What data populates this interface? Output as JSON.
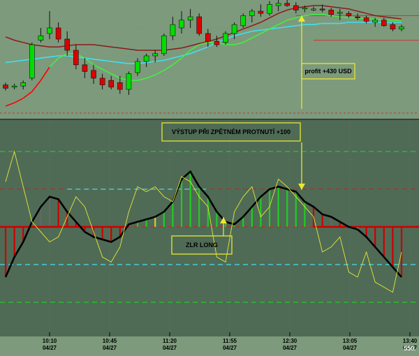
{
  "chart_data": [
    {
      "type": "candlestick",
      "panel": "price",
      "ylim": [
        0,
        100
      ],
      "colors": {
        "up": "#00dd00",
        "down": "#dd0000",
        "ma_slow": "#8b1a1a",
        "ma_fast_up": "#44ee44",
        "ma_fast_down": "#ff0000",
        "ma_cyan": "#40e0f0",
        "guide": "#cc3333",
        "background": "#7d9a7c"
      },
      "candles": [
        [
          24,
          26,
          19,
          21
        ],
        [
          22,
          25,
          20,
          23
        ],
        [
          23,
          28,
          20,
          26
        ],
        [
          30,
          62,
          28,
          60
        ],
        [
          64,
          75,
          62,
          68
        ],
        [
          70,
          90,
          65,
          75
        ],
        [
          75,
          80,
          62,
          65
        ],
        [
          65,
          72,
          50,
          55
        ],
        [
          55,
          60,
          38,
          42
        ],
        [
          42,
          48,
          30,
          36
        ],
        [
          37,
          42,
          25,
          30
        ],
        [
          30,
          34,
          20,
          24
        ],
        [
          28,
          32,
          20,
          22
        ],
        [
          26,
          32,
          16,
          20
        ],
        [
          20,
          36,
          15,
          34
        ],
        [
          35,
          48,
          32,
          45
        ],
        [
          45,
          52,
          40,
          50
        ],
        [
          50,
          55,
          44,
          52
        ],
        [
          52,
          70,
          50,
          68
        ],
        [
          68,
          85,
          64,
          78
        ],
        [
          75,
          90,
          70,
          82
        ],
        [
          82,
          92,
          75,
          85
        ],
        [
          85,
          88,
          68,
          70
        ],
        [
          70,
          74,
          58,
          63
        ],
        [
          63,
          68,
          58,
          60
        ],
        [
          62,
          72,
          60,
          70
        ],
        [
          70,
          80,
          65,
          78
        ],
        [
          77,
          88,
          75,
          86
        ],
        [
          86,
          92,
          80,
          90
        ],
        [
          90,
          96,
          85,
          88
        ],
        [
          88,
          99,
          86,
          96
        ],
        [
          95,
          100,
          90,
          97
        ],
        [
          97,
          100,
          94,
          95
        ],
        [
          95,
          98,
          88,
          91
        ],
        [
          92,
          95,
          89,
          93
        ],
        [
          92,
          94,
          90,
          92
        ],
        [
          92,
          96,
          89,
          91
        ],
        [
          91,
          93,
          85,
          87
        ],
        [
          88,
          92,
          82,
          89
        ],
        [
          88,
          90,
          84,
          86
        ],
        [
          85,
          88,
          82,
          84
        ],
        [
          84,
          86,
          79,
          81
        ],
        [
          80,
          84,
          76,
          82
        ],
        [
          82,
          84,
          76,
          77
        ],
        [
          78,
          80,
          72,
          74
        ],
        [
          74,
          78,
          72,
          76
        ]
      ],
      "ma_slow": [
        67,
        64,
        62,
        60,
        59,
        58,
        58,
        59,
        60,
        60,
        60,
        59,
        58,
        57,
        56,
        55,
        55,
        55,
        55,
        56,
        57,
        59,
        61,
        63,
        65,
        68,
        71,
        74,
        77,
        80,
        84,
        88,
        91,
        93,
        94,
        95,
        95,
        94,
        93,
        92,
        90,
        88,
        86,
        85,
        84,
        83
      ],
      "ma_fast": [
        5,
        8,
        12,
        18,
        28,
        40,
        48,
        52,
        52,
        48,
        42,
        38,
        34,
        30,
        28,
        28,
        30,
        33,
        37,
        42,
        48,
        55,
        60,
        62,
        62,
        60,
        60,
        62,
        66,
        70,
        74,
        78,
        82,
        84,
        86,
        87,
        87,
        86,
        85,
        84,
        84,
        83,
        83,
        82,
        82,
        82
      ],
      "ma_fast_color": [
        "down",
        "down",
        "down",
        "down",
        "down",
        "down",
        "up",
        "up",
        "up",
        "up",
        "up",
        "up",
        "up",
        "up",
        "up",
        "up",
        "up",
        "up",
        "up",
        "up",
        "up",
        "up",
        "up",
        "up",
        "up",
        "up",
        "up",
        "up",
        "up",
        "up",
        "up",
        "up",
        "up",
        "up",
        "up",
        "up",
        "up",
        "up",
        "up",
        "up",
        "up",
        "up",
        "up",
        "up",
        "up",
        "up"
      ],
      "ma_cyan": [
        44,
        45,
        46,
        47,
        48,
        49,
        50,
        50,
        49,
        48,
        47,
        46,
        45,
        44,
        43,
        43,
        44,
        45,
        46,
        48,
        50,
        52,
        55,
        58,
        62,
        65,
        68,
        70,
        72,
        73,
        74,
        75,
        76,
        77,
        78,
        78,
        79,
        79,
        79,
        80,
        80,
        80,
        80,
        80,
        80,
        80
      ],
      "annotations": [
        {
          "text": "profit +430 USD"
        }
      ]
    },
    {
      "type": "line",
      "panel": "oscillator",
      "ylim": [
        -200,
        200
      ],
      "levels": [
        {
          "value": 150,
          "color": "#22cc22"
        },
        {
          "value": 75,
          "color": "#cc2222"
        },
        {
          "value": 75,
          "color": "#40e0f0",
          "start": 7,
          "end": 23
        },
        {
          "value": 0,
          "color": "#cc2222"
        },
        {
          "value": -75,
          "color": "#40e0f0"
        },
        {
          "value": -150,
          "color": "#22cc22"
        }
      ],
      "series": [
        {
          "style": "thick",
          "color": "#000000",
          "values": [
            -100,
            -60,
            -30,
            10,
            40,
            60,
            55,
            30,
            10,
            -10,
            -20,
            -25,
            -30,
            -20,
            5,
            10,
            15,
            20,
            30,
            50,
            95,
            110,
            80,
            60,
            30,
            10,
            5,
            20,
            40,
            60,
            75,
            80,
            75,
            70,
            50,
            40,
            25,
            20,
            10,
            0,
            -5,
            -20,
            -40,
            -60,
            -80,
            -100
          ]
        },
        {
          "style": "thin",
          "color": "#e8e830",
          "values": [
            90,
            150,
            80,
            10,
            -10,
            -30,
            -20,
            20,
            60,
            40,
            -10,
            -60,
            -70,
            -40,
            30,
            80,
            70,
            80,
            60,
            50,
            100,
            90,
            60,
            40,
            -60,
            -70,
            30,
            60,
            80,
            20,
            40,
            95,
            80,
            60,
            40,
            20,
            -50,
            -40,
            -20,
            -90,
            -100,
            -50,
            -110,
            -120,
            -130,
            -50
          ]
        }
      ],
      "histogram": {
        "values": [
          -100,
          -60,
          -30,
          10,
          40,
          60,
          55,
          30,
          10,
          -10,
          -20,
          -25,
          -30,
          -20,
          5,
          10,
          15,
          20,
          30,
          50,
          95,
          110,
          80,
          60,
          30,
          10,
          5,
          20,
          40,
          60,
          75,
          80,
          75,
          70,
          50,
          40,
          25,
          20,
          10,
          0,
          -5,
          -20,
          -40,
          -60,
          -80,
          -100
        ],
        "colors": [
          "#cc0000",
          "#cc0000",
          "#cc0000",
          "#666666",
          "#666666",
          "#666666",
          "#cc0000",
          "#cc0000",
          "#cc0000",
          "#cc0000",
          "#cc0000",
          "#cc0000",
          "#cc0000",
          "#cc0000",
          "#666666",
          "#22cc22",
          "#22cc22",
          "#cccc44",
          "#22cc22",
          "#22cc22",
          "#22cc22",
          "#22cc22",
          "#22cc22",
          "#22cc22",
          "#22cc22",
          "#22cc22",
          "#22cc22",
          "#22cc22",
          "#22cc22",
          "#22cc22",
          "#22cc22",
          "#22cc22",
          "#22cc22",
          "#22cc22",
          "#22cc22",
          "#cc0000",
          "#cc0000",
          "#666666",
          "#cc0000",
          "#cc0000",
          "#cccc44",
          "#cc0000",
          "#cc0000",
          "#cc0000",
          "#cc0000",
          "#cc0000"
        ]
      },
      "annotations": [
        {
          "text": "VÝSTUP PŘI ZPĚTNÉM PROTNUTÍ +100"
        },
        {
          "text": "ZLR LONG"
        }
      ],
      "x_ticks": [
        {
          "time": "10:10",
          "date": "04/27"
        },
        {
          "time": "10:45",
          "date": "04/27"
        },
        {
          "time": "11:20",
          "date": "04/27"
        },
        {
          "time": "11:55",
          "date": "04/27"
        },
        {
          "time": "12:30",
          "date": "04/27"
        },
        {
          "time": "13:05",
          "date": "04/27"
        },
        {
          "time": "13:40",
          "date": "04/27"
        }
      ],
      "corner_value": "550."
    }
  ]
}
